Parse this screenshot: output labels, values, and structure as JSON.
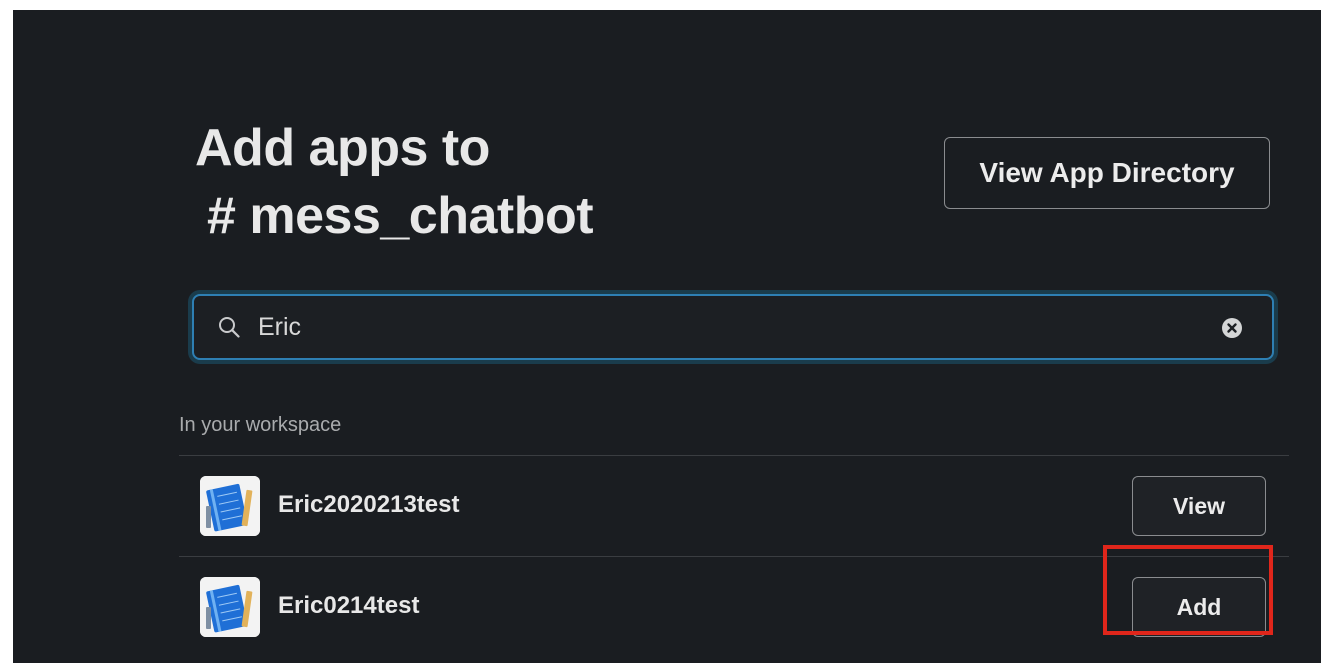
{
  "dialog": {
    "title_line1": "Add apps to",
    "title_line2": "# mess_chatbot",
    "view_directory_label": "View App Directory"
  },
  "search": {
    "value": "Eric",
    "placeholder": ""
  },
  "section": {
    "label": "In your workspace"
  },
  "apps": [
    {
      "name": "Eric2020213test",
      "action_label": "View"
    },
    {
      "name": "Eric0214test",
      "action_label": "Add"
    }
  ],
  "icons": {
    "search": "search-icon",
    "clear": "clear-icon",
    "app": "app-notebook-icon"
  },
  "colors": {
    "background": "#1a1d21",
    "focus_ring": "#2e7fb3",
    "highlight": "#e0261b",
    "text": "#e8e8e8"
  }
}
